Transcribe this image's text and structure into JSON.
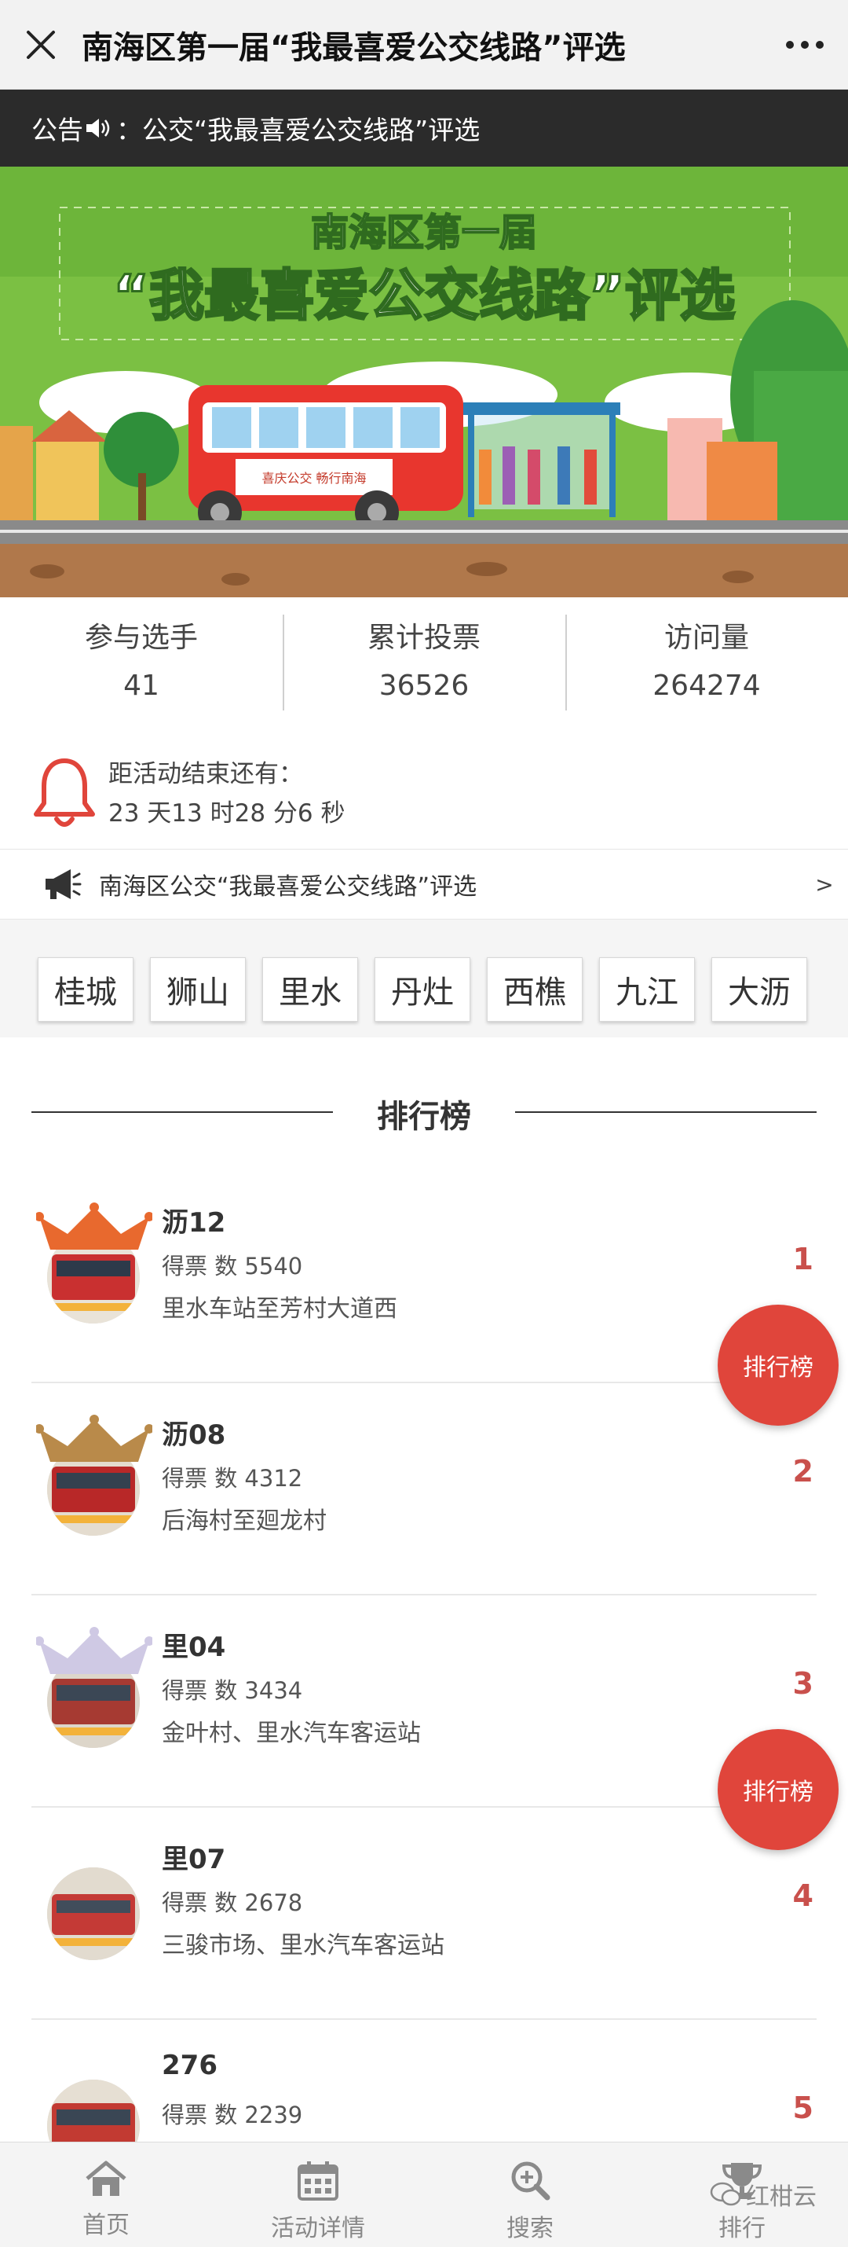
{
  "header": {
    "title": "南海区第一届“我最喜爱公交线路”评选"
  },
  "notice": {
    "prefix": "公告",
    "text": "：公交“我最喜爱公交线路”评选"
  },
  "banner": {
    "line1": "南海区第一届",
    "line2": "“我最喜爱公交线路”评选",
    "bus_text": "喜庆公交 畅行南海"
  },
  "stats": [
    {
      "label": "参与选手",
      "value": "41"
    },
    {
      "label": "累计投票",
      "value": "36526"
    },
    {
      "label": "访问量",
      "value": "264274"
    }
  ],
  "countdown": {
    "label": "距活动结束还有：",
    "value": "23 天13 时28 分6 秒"
  },
  "news": {
    "text": "南海区公交“我最喜爱公交线路”评选",
    "arrow": ">"
  },
  "districts": [
    "桂城",
    "狮山",
    "里水",
    "丹灶",
    "西樵",
    "九江",
    "大沥"
  ],
  "ranking": {
    "title": "排行榜",
    "items": [
      {
        "name": "沥12",
        "votes_label": "得票 数 5540",
        "stops": "里水车站至芳村大道西",
        "rank": "1",
        "crown_color": "#e8692e"
      },
      {
        "name": "沥08",
        "votes_label": "得票 数 4312",
        "stops": "后海村至廻龙村",
        "rank": "2",
        "crown_color": "#b98a4a"
      },
      {
        "name": "里04",
        "votes_label": "得票 数 3434",
        "stops": "金叶村、里水汽车客运站",
        "rank": "3",
        "crown_color": "#cfc9e4"
      },
      {
        "name": "里07",
        "votes_label": "得票 数 2678",
        "stops": "三骏市场、里水汽车客运站",
        "rank": "4",
        "crown_color": ""
      },
      {
        "name": "276",
        "votes_label": "得票 数 2239",
        "stops": "",
        "rank": "5",
        "crown_color": ""
      }
    ]
  },
  "float_buttons": [
    "排行榜",
    "排行榜"
  ],
  "nav": [
    {
      "label": "首页",
      "icon": "home-icon"
    },
    {
      "label": "活动详情",
      "icon": "calendar-icon"
    },
    {
      "label": "搜索",
      "icon": "search-plus-icon"
    },
    {
      "label": "排行",
      "icon": "trophy-icon"
    }
  ],
  "watermark": "红柑云",
  "colors": {
    "accent": "#e0453b",
    "rank": "#c9504c",
    "banner_green": "#7bc043"
  }
}
